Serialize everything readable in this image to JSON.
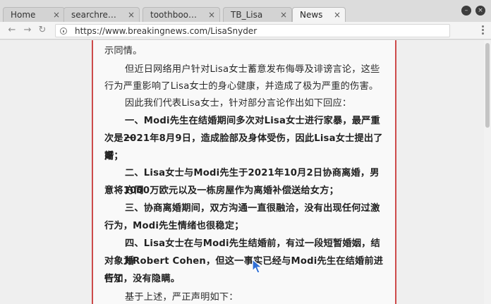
{
  "tabs": [
    {
      "label": "Home",
      "close": "×"
    },
    {
      "label": "searchre…",
      "close": "×"
    },
    {
      "label": "toothboo…",
      "close": "×"
    },
    {
      "label": "TB_Lisa",
      "close": "×"
    },
    {
      "label": "News",
      "close": "×"
    }
  ],
  "window_controls": {
    "minimize": "–",
    "close": "×"
  },
  "address_bar": {
    "url": "https://www.breakingnews.com/LisaSnyder"
  },
  "nav": {
    "back": "←",
    "forward": "→",
    "reload": "↻"
  },
  "article": {
    "p0": "示同情。",
    "p1a": "但近日网络用户针对Lisa女士蓄意发布侮辱及诽谤言论，这些",
    "p1b": "行为严重影响了Lisa女士的身心健康，并造成了极为严重的伤害。",
    "p2": "因此我们代表Lisa女士，针对部分言论作出如下回应：",
    "p3a": "一、Modi先生在结婚期间多次对Lisa女士进行家暴，最严重一",
    "p3b": "次是2021年8月9日，造成脸部及身体受伤，因此Lisa女士提出了离",
    "p3c": "婚；",
    "p4a": "二、Lisa女士与Modi先生于2021年10月2日协商离婚，男方同",
    "p4b": "意将1000万欧元以及一栋房屋作为离婚补偿送给女方；",
    "p5a": "三、协商离婚期间，双方沟通一直很融洽，没有出现任何过激",
    "p5b": "行为，Modi先生情绪也很稳定；",
    "p6a": "四、Lisa女士在与Modi先生结婚前，有过一段短暂婚姻，结婚",
    "p6b": "对象为Robert Cohen，但这一事实已经与Modi先生在结婚前进行了",
    "p6c": "告知，没有隐瞒。",
    "p7": "基于上述，严正声明如下："
  }
}
